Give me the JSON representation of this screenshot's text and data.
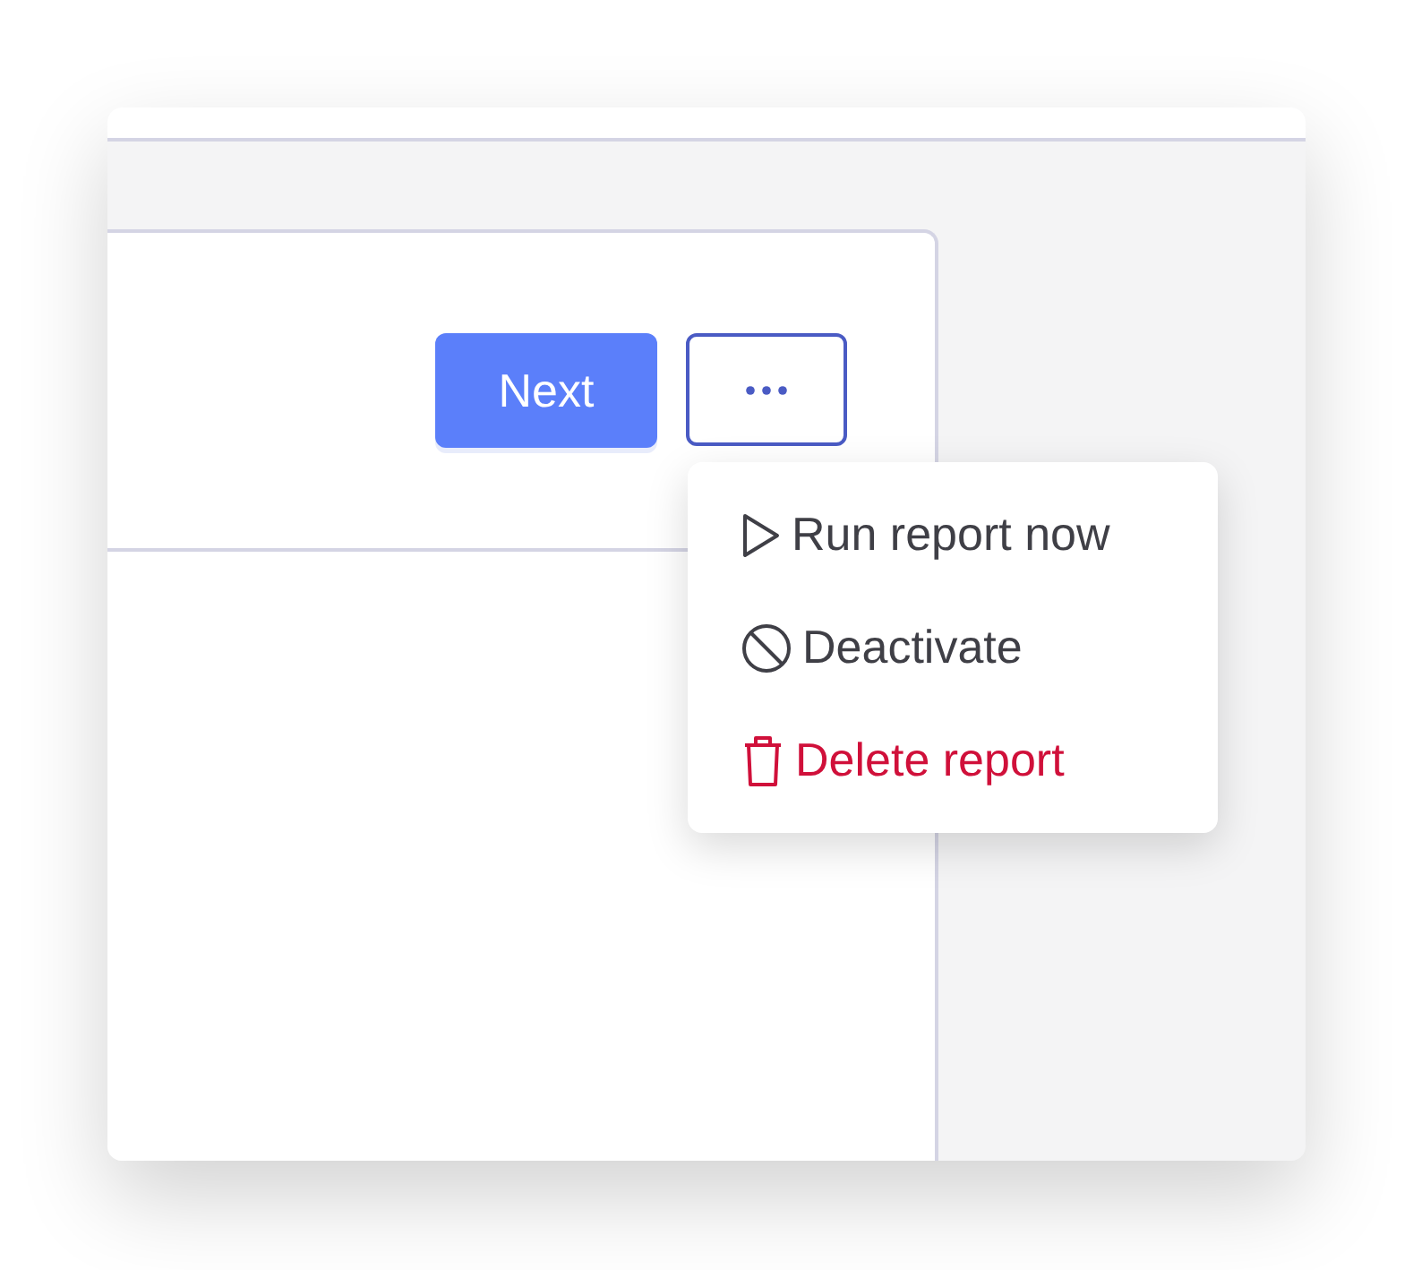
{
  "toolbar": {
    "primary_button": "Next"
  },
  "menu": {
    "items": [
      {
        "kind": "run",
        "label": "Run report now"
      },
      {
        "kind": "deactivate",
        "label": "Deactivate"
      },
      {
        "kind": "delete",
        "label": "Delete report"
      }
    ]
  }
}
